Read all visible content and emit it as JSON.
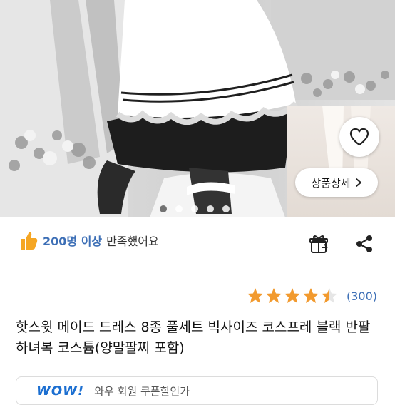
{
  "hero": {
    "detail_button_label": "상품상세",
    "slide_count": 5,
    "active_slide": 1
  },
  "satisfaction": {
    "count_text": "200명 이상",
    "suffix_text": "만족했어요"
  },
  "rating": {
    "stars": 4.5,
    "count_text": "(300)"
  },
  "product": {
    "title": "핫스윗 메이드 드레스 8종 풀세트 빅사이즈 코스프레 블랙 반팔 하녀복 코스튬(양말팔찌 포함)"
  },
  "promo": {
    "logo": "WOW!",
    "text": "와우 회원 쿠폰할인가"
  },
  "colors": {
    "accent_blue": "#3d6fb6",
    "star_orange": "#f29a2e",
    "thumb_yellow": "#f5a623"
  },
  "icons": [
    "heart-icon",
    "chevron-right-icon",
    "thumbs-up-icon",
    "gift-icon",
    "share-icon",
    "star-icon"
  ]
}
